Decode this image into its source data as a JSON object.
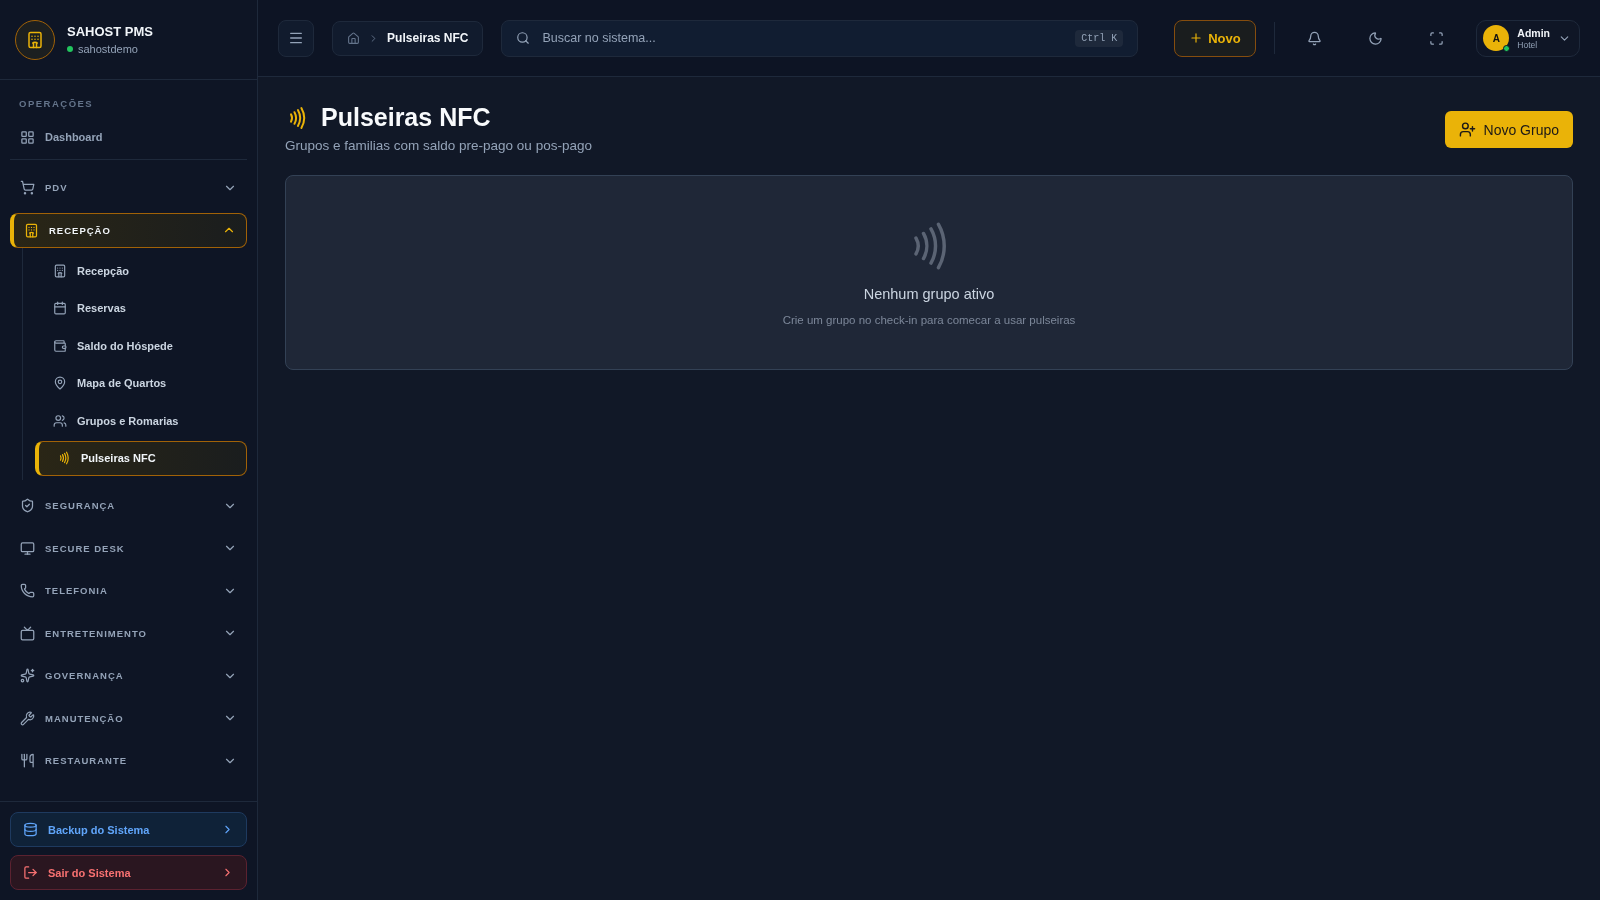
{
  "brand": {
    "name": "SAHOST PMS",
    "tenant": "sahostdemo",
    "online": true
  },
  "sidebar": {
    "section_label": "OPERAÇÕES",
    "items": [
      {
        "kind": "link",
        "label": "Dashboard",
        "selected": false
      },
      {
        "kind": "group",
        "label": "PDV",
        "expanded": false,
        "selected": false
      },
      {
        "kind": "group",
        "label": "RECEPÇÃO",
        "expanded": true,
        "selected": true,
        "children": [
          {
            "label": "Recepção",
            "selected": false
          },
          {
            "label": "Reservas",
            "selected": false
          },
          {
            "label": "Saldo do Hóspede",
            "selected": false
          },
          {
            "label": "Mapa de Quartos",
            "selected": false
          },
          {
            "label": "Grupos e Romarias",
            "selected": false
          },
          {
            "label": "Pulseiras NFC",
            "selected": true
          }
        ]
      },
      {
        "kind": "group",
        "label": "SEGURANÇA",
        "expanded": false,
        "selected": false
      },
      {
        "kind": "group",
        "label": "SECURE DESK",
        "expanded": false,
        "selected": false
      },
      {
        "kind": "group",
        "label": "TELEFONIA",
        "expanded": false,
        "selected": false
      },
      {
        "kind": "group",
        "label": "ENTRETENIMENTO",
        "expanded": false,
        "selected": false
      },
      {
        "kind": "group",
        "label": "GOVERNANÇA",
        "expanded": false,
        "selected": false
      },
      {
        "kind": "group",
        "label": "MANUTENÇÃO",
        "expanded": false,
        "selected": false
      },
      {
        "kind": "group",
        "label": "RESTAURANTE",
        "expanded": false,
        "selected": false
      }
    ],
    "footer_buttons": [
      {
        "kind": "backup",
        "label": "Backup do Sistema"
      },
      {
        "kind": "logout",
        "label": "Sair do Sistema"
      }
    ]
  },
  "topbar": {
    "breadcrumb": "Pulseiras NFC",
    "search": {
      "placeholder": "Buscar no sistema...",
      "shortcut": "Ctrl K"
    },
    "new_button": "Novo",
    "user": {
      "initial": "A",
      "name": "Admin",
      "role": "Hotel",
      "online": true
    }
  },
  "page": {
    "title": "Pulseiras NFC",
    "subtitle": "Grupos e familias com saldo pre-pago ou pos-pago",
    "action": "Novo Grupo",
    "empty_state": {
      "title": "Nenhum grupo ativo",
      "message": "Crie um grupo no check-in para comecar a usar pulseiras"
    }
  }
}
